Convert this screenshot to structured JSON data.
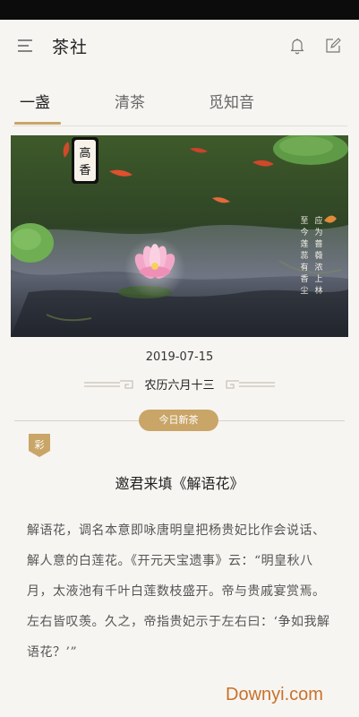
{
  "header": {
    "title": "茶社",
    "icons": [
      "menu-icon",
      "bell-icon",
      "edit-icon"
    ]
  },
  "tabs": [
    {
      "label": "一盏",
      "active": true
    },
    {
      "label": "清茶",
      "active": false
    },
    {
      "label": "觅知音",
      "active": false
    }
  ],
  "hero": {
    "seal_text": "高香",
    "calligraphy_right": "应为蔷薇浓上林",
    "calligraphy_left": "至今莲蕊有香尘"
  },
  "date": {
    "gregorian": "2019-07-15",
    "lunar": "农历六月十三"
  },
  "badge": {
    "label": "今日新茶"
  },
  "category": {
    "label": "彩"
  },
  "article": {
    "title": "邀君来填《解语花》",
    "body": "解语花，调名本意即咏唐明皇把杨贵妃比作会说话、解人意的白莲花。《开元天宝遗事》云：“明皇秋八月，太液池有千叶白莲数枝盛开。帝与贵戚宴赏焉。左右皆叹羡。久之，帝指贵妃示于左右曰：‘争如我解语花？’”"
  },
  "watermark": "Downyi.com",
  "colors": {
    "accent": "#c9a567",
    "background": "#f7f5f2",
    "status_bar": "#0c0c0c"
  }
}
